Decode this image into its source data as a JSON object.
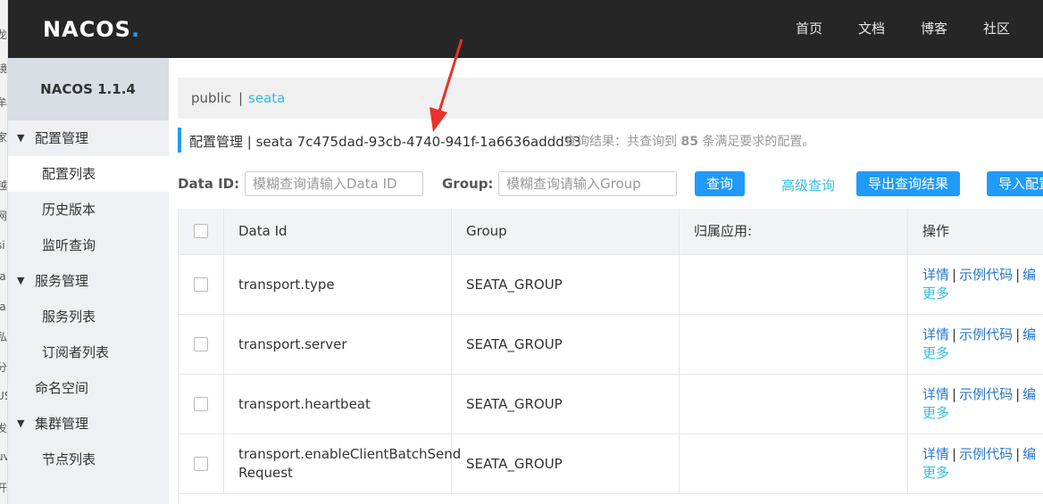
{
  "left_strip": [
    "龙",
    "镜",
    "牟",
    "家",
    "越",
    "网",
    "si",
    "la",
    "la",
    "私",
    "分",
    "US",
    "发",
    "uv",
    "开"
  ],
  "header": {
    "logo_main": "NACOS",
    "logo_dot": ".",
    "nav": [
      "首页",
      "文档",
      "博客",
      "社区"
    ]
  },
  "sidebar": {
    "version": "NACOS 1.1.4",
    "groups": [
      {
        "label": "配置管理",
        "items": [
          "配置列表",
          "历史版本",
          "监听查询"
        ]
      },
      {
        "label": "服务管理",
        "items": [
          "服务列表",
          "订阅者列表"
        ]
      },
      {
        "label": "命名空间"
      },
      {
        "label": "集群管理",
        "items": [
          "节点列表"
        ]
      }
    ]
  },
  "breadcrumb": {
    "ns1": "public",
    "sep": "|",
    "ns2": "seata"
  },
  "title": {
    "text": "配置管理  |  seata  7c475dad-93cb-4740-941f-1a6636addd93",
    "result_prefix": "查询结果：共查询到",
    "result_count": "85",
    "result_suffix": "条满足要求的配置。"
  },
  "search": {
    "dataid_label": "Data ID:",
    "dataid_placeholder": "模糊查询请输入Data ID",
    "group_label": "Group:",
    "group_placeholder": "模糊查询请输入Group",
    "query_btn": "查询",
    "advanced": "高级查询",
    "export_btn": "导出查询结果",
    "import_btn": "导入配置"
  },
  "table": {
    "headers": [
      "Data Id",
      "Group",
      "归属应用:",
      "操作"
    ],
    "rows": [
      {
        "data_id": "transport.type",
        "group": "SEATA_GROUP",
        "app": ""
      },
      {
        "data_id": "transport.server",
        "group": "SEATA_GROUP",
        "app": ""
      },
      {
        "data_id": "transport.heartbeat",
        "group": "SEATA_GROUP",
        "app": ""
      },
      {
        "data_id_line1": "transport.enableClientBatchSend",
        "data_id_line2": "Request",
        "group": "SEATA_GROUP",
        "app": ""
      }
    ],
    "ops": {
      "detail": "详情",
      "sample": "示例代码",
      "edit": "编",
      "more": "更多",
      "pipe": "|"
    }
  },
  "colors": {
    "accent": "#209bfa",
    "link": "#2878c9",
    "annotation": "#e8322a"
  }
}
